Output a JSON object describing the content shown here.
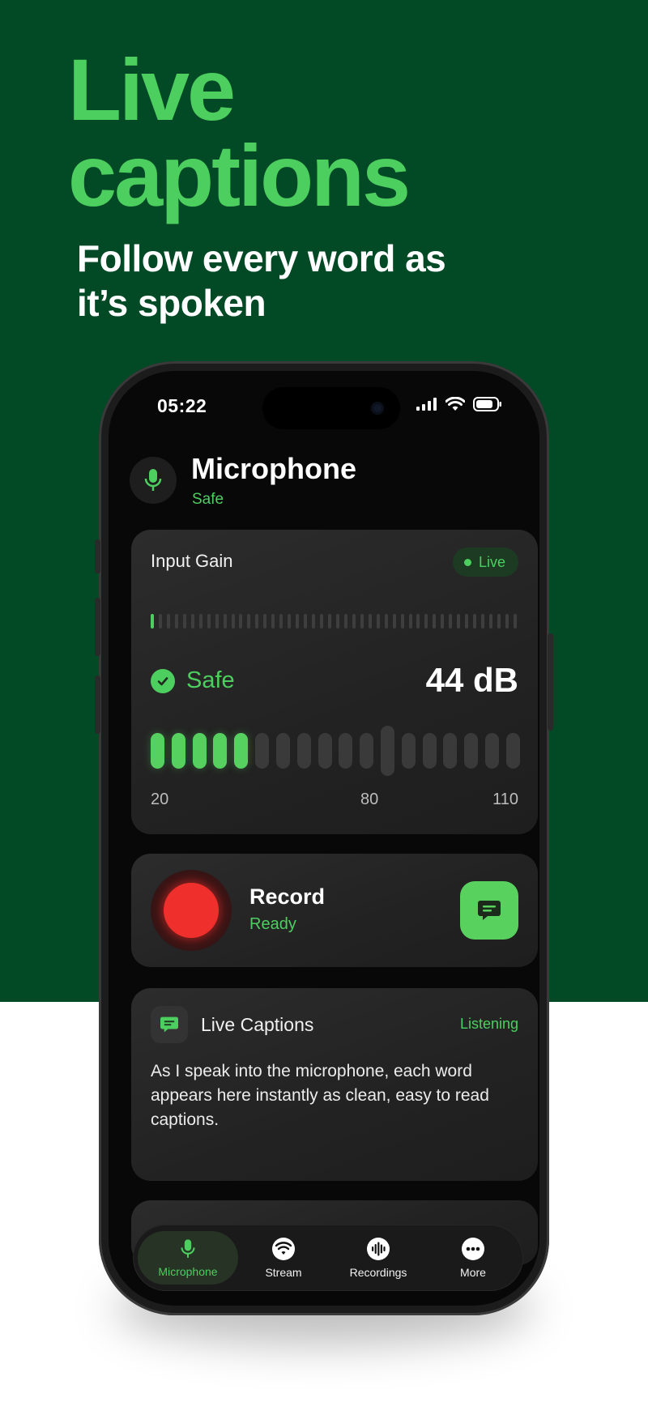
{
  "promo": {
    "headline_line1": "Live",
    "headline_line2": "captions",
    "subhead_line1": "Follow every word as",
    "subhead_line2": "it’s spoken"
  },
  "status_bar": {
    "time": "05:22"
  },
  "header": {
    "title": "Microphone",
    "subtitle": "Safe"
  },
  "input_gain": {
    "title": "Input Gain",
    "badge": "Live",
    "status": "Safe",
    "level": "44 dB",
    "scale": [
      "20",
      "80",
      "110"
    ],
    "active_bars": 5,
    "total_bars": 18
  },
  "record": {
    "title": "Record",
    "status": "Ready"
  },
  "captions": {
    "title": "Live Captions",
    "status": "Listening",
    "text": "As I speak into the microphone, each word appears here instantly as clean, easy to read captions."
  },
  "tabs": [
    {
      "label": "Microphone",
      "icon": "mic-icon",
      "active": true
    },
    {
      "label": "Stream",
      "icon": "wifi-icon",
      "active": false
    },
    {
      "label": "Recordings",
      "icon": "waveform-icon",
      "active": false
    },
    {
      "label": "More",
      "icon": "more-icon",
      "active": false
    }
  ],
  "colors": {
    "brand_dark": "#024a26",
    "accent": "#4ccf5f",
    "record": "#ef2f2b"
  }
}
